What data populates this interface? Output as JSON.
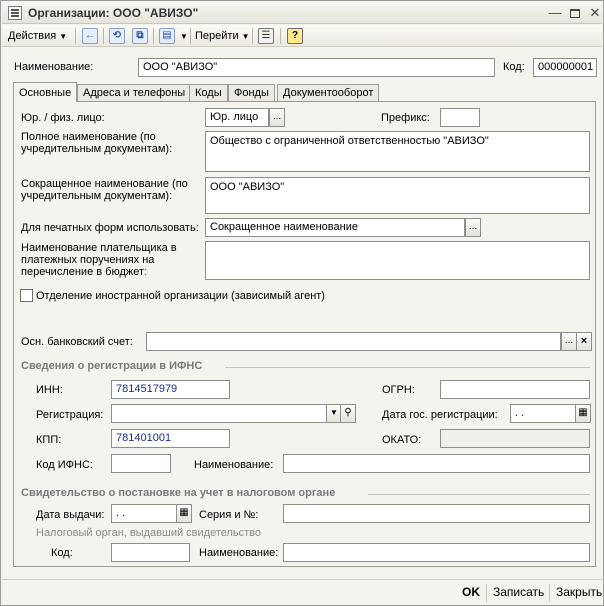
{
  "window": {
    "title": "Организации: ООО \"АВИЗО\"",
    "min_glyph": "—",
    "close_glyph": "✕"
  },
  "toolbar": {
    "actions_label": "Действия",
    "goto_label": "Перейти",
    "help_glyph": "?",
    "icons": [
      "back-arrow-icon",
      "refresh-icon",
      "copy-icon",
      "structure-icon",
      "list-icon",
      "help-icon"
    ]
  },
  "header": {
    "name_label": "Наименование:",
    "name_value": "ООО \"АВИЗО\"",
    "code_label": "Код:",
    "code_value": "000000001"
  },
  "tabs": [
    {
      "label": "Основные",
      "active": true
    },
    {
      "label": "Адреса и телефоны",
      "active": false
    },
    {
      "label": "Коды",
      "active": false
    },
    {
      "label": "Фонды",
      "active": false
    },
    {
      "label": "Документооборот",
      "active": false
    }
  ],
  "main": {
    "legal_type_label": "Юр. / физ. лицо:",
    "legal_type_value": "Юр. лицо",
    "prefix_label": "Префикс:",
    "prefix_value": "",
    "full_name_label": "Полное наименование (по учредительным документам):",
    "full_name_value": "Общество с ограниченной ответственностью \"АВИЗО\"",
    "short_name_label": "Сокращенное наименование (по учредительным документам):",
    "short_name_value": "ООО \"АВИЗО\"",
    "print_forms_label": "Для печатных форм использовать:",
    "print_forms_value": "Сокращенное наименование",
    "payer_name_label": "Наименование плательщика в платежных поручениях на перечисление в бюджет:",
    "payer_name_value": "",
    "foreign_branch_label": "Отделение иностранной организации (зависимый агент)",
    "bank_account_label": "Осн. банковский счет:",
    "bank_account_value": ""
  },
  "registration": {
    "title": "Сведения о регистрации в ИФНС",
    "inn_label": "ИНН:",
    "inn_value": "7814517979",
    "ogrn_label": "ОГРН:",
    "ogrn_value": "",
    "reg_label": "Регистрация:",
    "reg_value": "",
    "reg_date_label": "Дата гос. регистрации:",
    "reg_date_value": " .  .",
    "kpp_label": "КПП:",
    "kpp_value": "781401001",
    "okato_label": "ОКАТО:",
    "okato_value": "",
    "ifns_code_label": "Код ИФНС:",
    "ifns_code_value": "",
    "ifns_name_label": "Наименование:",
    "ifns_name_value": ""
  },
  "certificate": {
    "title": "Свидетельство о постановке на учет в налоговом органе",
    "issue_date_label": "Дата выдачи:",
    "issue_date_value": " .  .",
    "series_label": "Серия и №:",
    "series_value": "",
    "issuer_note": "Налоговый орган, выдавший свидетельство",
    "code_label": "Код:",
    "code_value": "",
    "name_label": "Наименование:",
    "name_value": ""
  },
  "footer": {
    "ok_label": "OK",
    "save_label": "Записать",
    "close_label": "Закрыть"
  }
}
